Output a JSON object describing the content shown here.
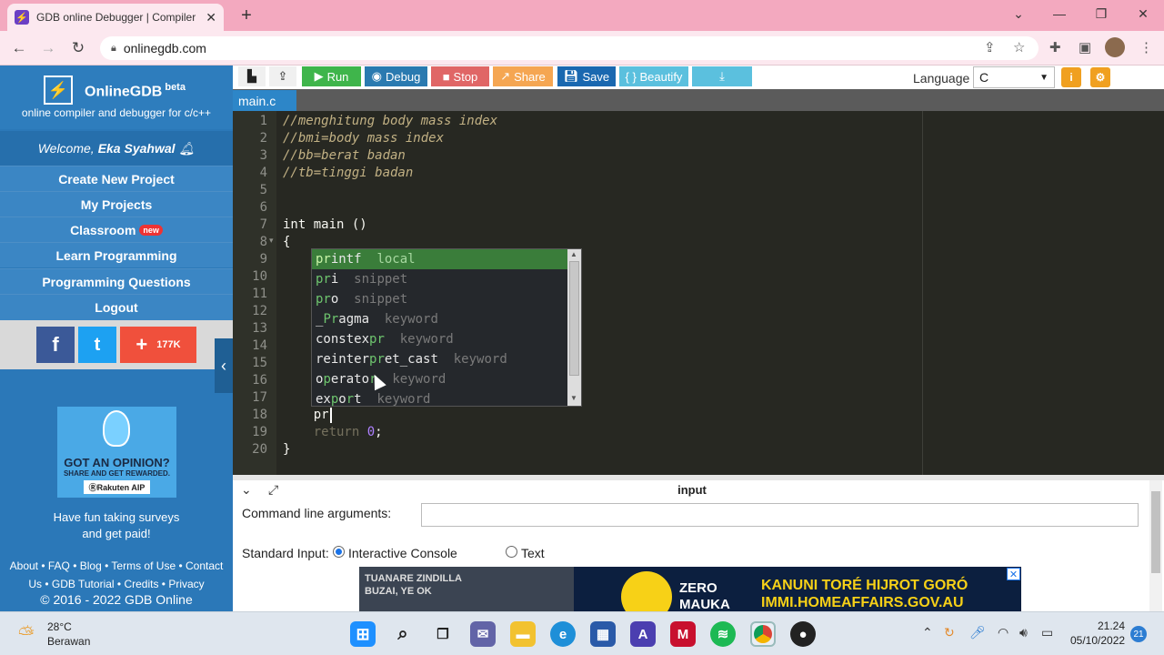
{
  "browser": {
    "tab_title": "GDB online Debugger | Compiler",
    "tab_close": "✕",
    "new_tab": "+",
    "url": "onlinegdb.com",
    "window_controls": [
      "⌄",
      "—",
      "❐",
      "✕"
    ]
  },
  "sidebar": {
    "brand": "OnlineGDB",
    "brand_sup": "beta",
    "tagline": "online compiler and debugger for c/c++",
    "welcome_prefix": "Welcome,",
    "welcome_user": "Eka Syahwal",
    "menu": [
      {
        "label": "Create New Project"
      },
      {
        "label": "My Projects"
      },
      {
        "label": "Classroom",
        "badge": "new"
      },
      {
        "label": "Learn Programming"
      },
      {
        "label": "Programming Questions"
      },
      {
        "label": "Logout"
      }
    ],
    "social": {
      "facebook": "f",
      "twitter": "t",
      "share_plus": "+",
      "share_count": "177K"
    },
    "ad": {
      "title": "GOT AN OPINION?",
      "subtitle": "SHARE AND GET REWARDED.",
      "brand": "ⓇRakuten AIP"
    },
    "survey_line1": "Have fun taking surveys",
    "survey_line2": "and get paid!",
    "footer_line1": "About • FAQ • Blog • Terms of Use • Contact",
    "footer_line2": "Us • GDB Tutorial • Credits • Privacy",
    "copyright": "© 2016 - 2022 GDB Online"
  },
  "toolbar": {
    "run": "Run",
    "debug": "Debug",
    "stop": "Stop",
    "share": "Share",
    "save": "Save",
    "beautify": "{ } Beautify",
    "language_label": "Language",
    "language_value": "C",
    "colors": {
      "run": "#3fb54b",
      "debug": "#2a7ab0",
      "stop": "#e06666",
      "share": "#f5a652",
      "save": "#1a68b0",
      "beautify": "#5bc0de",
      "download": "#5bc0de"
    }
  },
  "editor": {
    "file_tab": "main.c",
    "lines": [
      {
        "n": "1",
        "text": "//menghitung body mass index"
      },
      {
        "n": "2",
        "text": "//bmi=body mass index"
      },
      {
        "n": "3",
        "text": "//bb=berat badan"
      },
      {
        "n": "4",
        "text": "//tb=tinggi badan"
      },
      {
        "n": "5",
        "text": ""
      },
      {
        "n": "6",
        "text": ""
      },
      {
        "n": "7",
        "text": "int main ()"
      },
      {
        "n": "8",
        "text": "{"
      },
      {
        "n": "9",
        "text": ""
      },
      {
        "n": "10",
        "text": ""
      },
      {
        "n": "11",
        "text": ""
      },
      {
        "n": "12",
        "text": ""
      },
      {
        "n": "13",
        "text": ""
      },
      {
        "n": "14",
        "text": ""
      },
      {
        "n": "15",
        "text": ""
      },
      {
        "n": "16",
        "text": ""
      },
      {
        "n": "17",
        "text": ""
      },
      {
        "n": "18",
        "text": "    pr"
      },
      {
        "n": "19",
        "text": "    return 0;"
      },
      {
        "n": "20",
        "text": "}"
      }
    ],
    "autocomplete": [
      {
        "pre": "",
        "hl": "pr",
        "post": "intf",
        "meta": "local"
      },
      {
        "pre": "",
        "hl": "pr",
        "post": "i",
        "meta": "snippet"
      },
      {
        "pre": "",
        "hl": "pr",
        "post": "o",
        "meta": "snippet"
      },
      {
        "pre": "_",
        "hl": "Pr",
        "post": "agma",
        "meta": "keyword"
      },
      {
        "pre": "constex",
        "hl": "pr",
        "post": "",
        "meta": "keyword"
      },
      {
        "pre": "reinter",
        "hl": "pr",
        "post": "et_cast",
        "meta": "keyword"
      },
      {
        "pre": "o",
        "hl": "p",
        "post": "erato",
        "hl2": "r",
        "meta": "keyword"
      },
      {
        "pre": "ex",
        "hl": "p",
        "post": "o",
        "hl2": "r",
        "post2": "t",
        "meta": "keyword"
      }
    ]
  },
  "input_panel": {
    "title": "input",
    "cmd_label": "Command line arguments:",
    "cmd_value": "",
    "stdin_label": "Standard Input:",
    "option_console": "Interactive Console",
    "option_text": "Text",
    "selected": "Interactive Console"
  },
  "bottom_ad": {
    "left_line1": "TUANARE ZINDILLA",
    "left_line2": "BUZAI, YE OK",
    "zero_line1": "ZERO",
    "zero_line2": "MAUKA",
    "right_line1": "KANUNI TORÉ HIJROT GORÓ",
    "right_line2": "IMMI.HOMEAFFAIRS.GOV.AU",
    "close": "✕"
  },
  "taskbar": {
    "temperature": "28°C",
    "weather": "Berawan",
    "time": "21.24",
    "date": "05/10/2022",
    "notification_count": "21"
  }
}
